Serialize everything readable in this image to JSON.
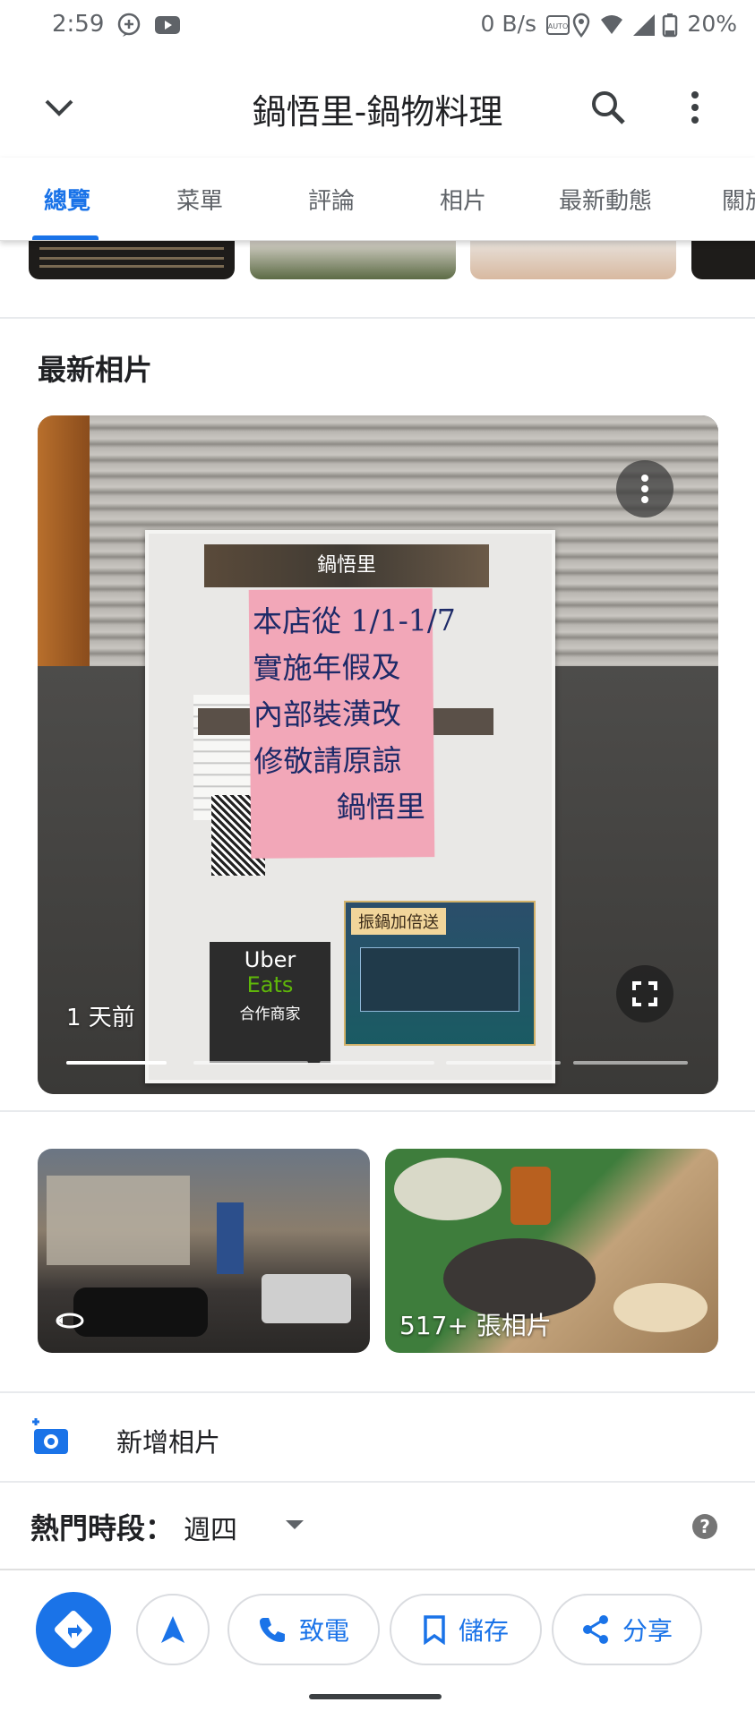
{
  "status_bar": {
    "time": "2:59",
    "right_text": "0 B/s",
    "battery": "20%"
  },
  "app_bar": {
    "title": "鍋悟里-鍋物料理"
  },
  "tabs": [
    {
      "label": "總覽",
      "active": true
    },
    {
      "label": "菜單",
      "active": false
    },
    {
      "label": "評論",
      "active": false
    },
    {
      "label": "相片",
      "active": false
    },
    {
      "label": "最新動態",
      "active": false
    },
    {
      "label": "關於",
      "active": false
    }
  ],
  "latest_photos": {
    "title": "最新相片",
    "photo_time": "1 天前",
    "sign_lines": [
      "本店從 1/1-1/7",
      "實施年假及",
      "內部裝潢改",
      "修敬請原諒",
      "鍋悟里"
    ],
    "sign_logo": "鍋悟里",
    "uber_title": "Uber",
    "uber_sub": "Eats",
    "uber_partner": "合作商家",
    "promo_title": "振鍋加倍送"
  },
  "more_photos": {
    "count_label": "517+ 張相片"
  },
  "add_photo": {
    "label": "新增相片"
  },
  "popular_times": {
    "title": "熱門時段：",
    "day": "週四"
  },
  "actions": {
    "call": "致電",
    "save": "儲存",
    "share": "分享"
  },
  "colors": {
    "accent": "#1a73e8"
  }
}
